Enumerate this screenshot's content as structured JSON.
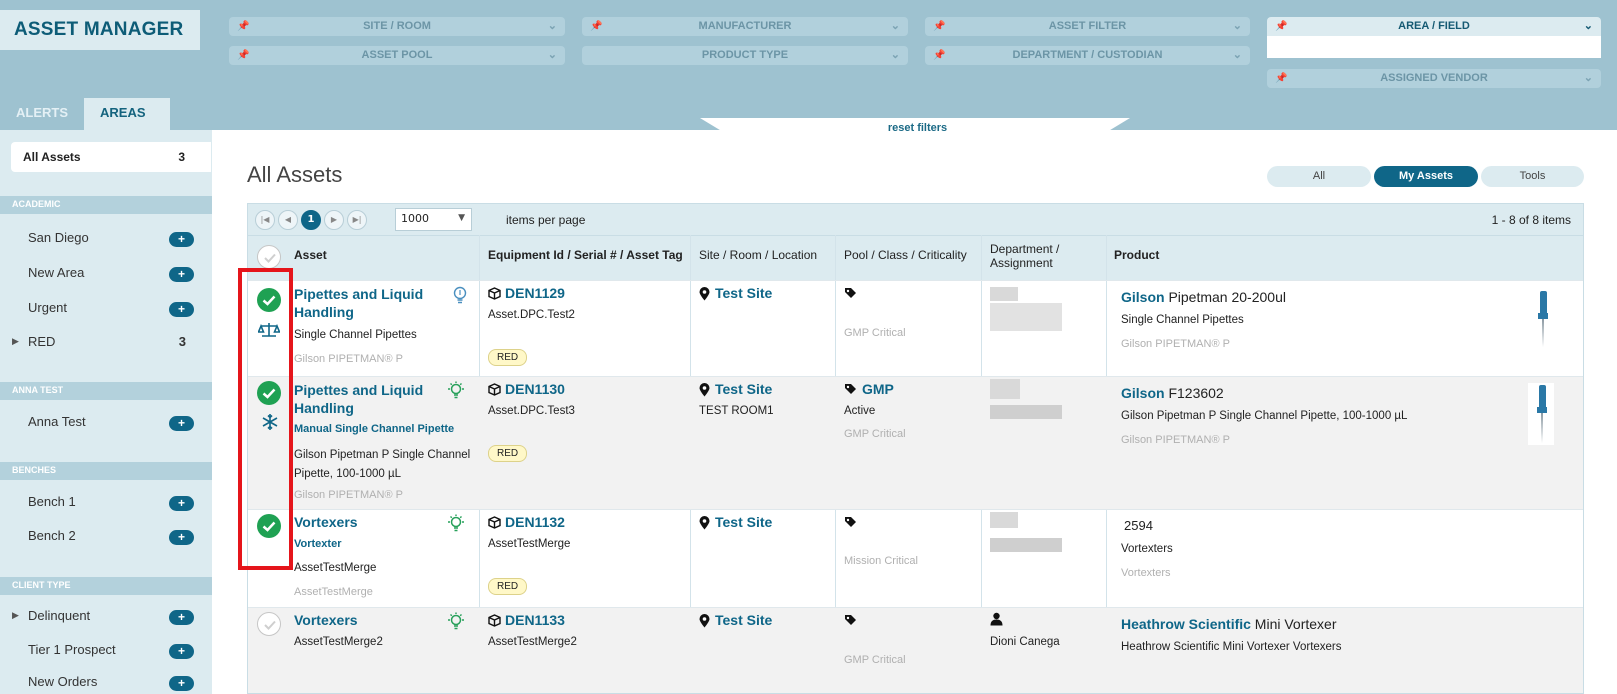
{
  "app": {
    "title": "ASSET MANAGER"
  },
  "filters": {
    "site_room": "SITE / ROOM",
    "manufacturer": "MANUFACTURER",
    "asset_filter": "ASSET FILTER",
    "area_field": "AREA / FIELD",
    "asset_pool": "ASSET POOL",
    "product_type": "PRODUCT TYPE",
    "department_custodian": "DEPARTMENT / CUSTODIAN",
    "assigned_vendor": "ASSIGNED VENDOR",
    "reset": "reset filters"
  },
  "tabs": {
    "alerts": "ALERTS",
    "areas": "AREAS"
  },
  "sidebar": {
    "all_assets_label": "All Assets",
    "all_assets_count": "3",
    "sections": [
      {
        "header": "ACADEMIC",
        "items": [
          {
            "label": "San Diego"
          },
          {
            "label": "New Area"
          },
          {
            "label": "Urgent"
          },
          {
            "label": "RED",
            "count": "3"
          }
        ]
      },
      {
        "header": "ANNA TEST",
        "items": [
          {
            "label": "Anna Test"
          }
        ]
      },
      {
        "header": "BENCHES",
        "items": [
          {
            "label": "Bench 1"
          },
          {
            "label": "Bench 2"
          }
        ]
      },
      {
        "header": "CLIENT TYPE",
        "items": [
          {
            "label": "Delinquent"
          },
          {
            "label": "Tier 1 Prospect"
          },
          {
            "label": "New Orders"
          }
        ]
      }
    ]
  },
  "main": {
    "title": "All Assets",
    "segments": {
      "all": "All",
      "my_assets": "My Assets",
      "tools": "Tools"
    },
    "pager": {
      "current_page": "1",
      "per_page": "1000",
      "per_page_label": "items per page",
      "range": "1 - 8 of 8 items"
    },
    "columns": {
      "asset": "Asset",
      "equipment_a": "Equipment Id",
      "equipment_b": " / Serial # / Asset Tag",
      "site": "Site / Room / Location",
      "pool": "Pool / Class / Criticality",
      "dept_line1": "Department /",
      "dept_line2": "Assignment",
      "product": "Product"
    },
    "rows": [
      {
        "asset_line1": "Pipettes and Liquid",
        "asset_line2": "Handling",
        "asset_desc": "Single Channel Pipettes",
        "asset_mfr": "Gilson PIPETMAN® P",
        "equip_id": "DEN1129",
        "equip_tag": "Asset.DPC.Test2",
        "equip_badge": "RED",
        "site": "Test Site",
        "pool_class": "GMP Critical",
        "prod_brand": "Gilson",
        "prod_model": " Pipetman 20-200ul",
        "prod_desc": "Single Channel Pipettes",
        "prod_sub": "Gilson PIPETMAN® P"
      },
      {
        "asset_line1": "Pipettes and Liquid",
        "asset_line2": "Handling",
        "asset_type": "Manual Single Channel Pipette",
        "asset_desc1": "Gilson Pipetman P Single Channel",
        "asset_desc2": "Pipette, 100-1000 µL",
        "asset_mfr": "Gilson PIPETMAN® P",
        "equip_id": "DEN1130",
        "equip_tag": "Asset.DPC.Test3",
        "equip_badge": "RED",
        "site": "Test Site",
        "room": "TEST ROOM1",
        "pool": "GMP",
        "pool_status": "Active",
        "pool_class": "GMP Critical",
        "prod_brand": "Gilson",
        "prod_model": " F123602",
        "prod_desc": "Gilson Pipetman P Single Channel Pipette, 100-1000 µL",
        "prod_sub": "Gilson PIPETMAN® P"
      },
      {
        "asset_line1": "Vortexers",
        "asset_type": "Vortexter",
        "asset_desc": "AssetTestMerge",
        "asset_mfr": "AssetTestMerge",
        "equip_id": "DEN1132",
        "equip_tag": "AssetTestMerge",
        "equip_badge": "RED",
        "site": "Test Site",
        "pool_class": "Mission Critical",
        "prod_model": "2594",
        "prod_desc": "Vortexters",
        "prod_sub": "Vortexters"
      },
      {
        "asset_line1": "Vortexers",
        "asset_desc": "AssetTestMerge2",
        "equip_id": "DEN1133",
        "equip_tag": "AssetTestMerge2",
        "site": "Test Site",
        "pool_class": "GMP Critical",
        "dept_person": "Dioni Canega",
        "prod_brand": "Heathrow Scientific",
        "prod_model": " Mini Vortexer",
        "prod_desc": "Heathrow Scientific Mini Vortexer Vortexers"
      }
    ]
  },
  "colors": {
    "brand": "#0f6688",
    "header_bg": "#9ec2d0",
    "panel": "#dcebf0",
    "ok": "#1fa153",
    "alert_outline": "#e5151b"
  }
}
